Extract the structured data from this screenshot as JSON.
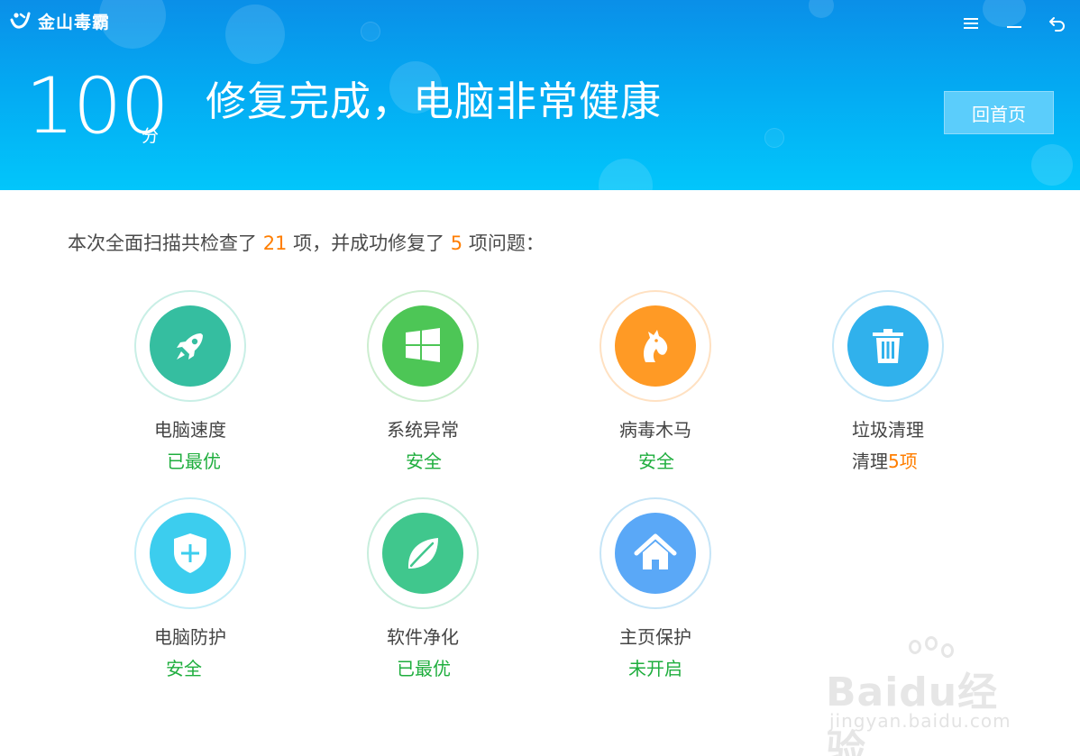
{
  "app": {
    "title": "金山毒霸"
  },
  "window_controls": [
    {
      "name": "menu-icon"
    },
    {
      "name": "minimize-icon"
    },
    {
      "name": "back-icon"
    }
  ],
  "header": {
    "score": "100",
    "score_unit": "分",
    "status": "修复完成，电脑非常健康",
    "home_button": "回首页"
  },
  "summary": {
    "prefix": "本次全面扫描共检查了",
    "checked": "21",
    "middle": "项，并成功修复了",
    "fixed": "5",
    "suffix": "项问题："
  },
  "items": [
    {
      "label": "电脑速度",
      "status": "已最优",
      "icon": "rocket-icon",
      "color": "#35bea0",
      "ring": "#c9efe6"
    },
    {
      "label": "系统异常",
      "status": "安全",
      "icon": "windows-icon",
      "color": "#4dc656",
      "ring": "#cdeed0"
    },
    {
      "label": "病毒木马",
      "status": "安全",
      "icon": "horse-icon",
      "color": "#ff9a25",
      "ring": "#ffe1c2"
    },
    {
      "label": "垃圾清理",
      "status_prefix": "清理",
      "status_count": "5项",
      "icon": "trash-icon",
      "color": "#30b1ec",
      "ring": "#c6e8f8"
    },
    {
      "label": "电脑防护",
      "status": "安全",
      "icon": "shield-icon",
      "color": "#3ccdee",
      "ring": "#c4eef8"
    },
    {
      "label": "软件净化",
      "status": "已最优",
      "icon": "leaf-icon",
      "color": "#40c78d",
      "ring": "#c8eedd"
    },
    {
      "label": "主页保护",
      "status": "未开启",
      "icon": "home-icon",
      "color": "#5aa8f7",
      "ring": "#c6e5f7"
    }
  ],
  "colors": {
    "highlight": "#ff7e00",
    "ok": "#1fae3e",
    "header_top": "#0a8fe8",
    "header_bottom": "#02c6fb"
  },
  "watermark": {
    "main": "Baidu经验",
    "sub": "jingyan.baidu.com"
  }
}
